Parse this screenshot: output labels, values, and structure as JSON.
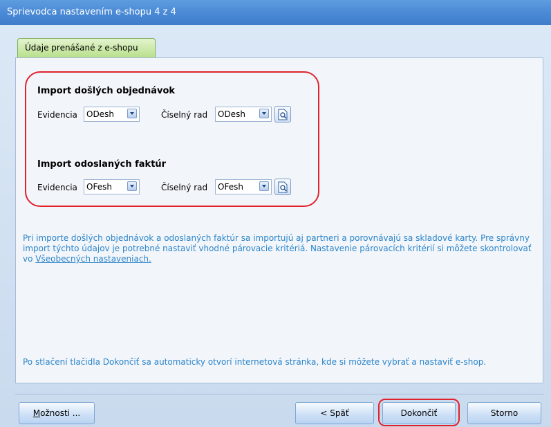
{
  "window": {
    "title": "Sprievodca nastavením e-shopu 4 z 4"
  },
  "tab": {
    "label": "Údaje prenášané z e-shopu"
  },
  "orders": {
    "title": "Import došlých objednávok",
    "evidencia_label": "Evidencia",
    "evidencia_value": "ODesh",
    "rad_label": "Číselný rad",
    "rad_value": "ODesh"
  },
  "invoices": {
    "title": "Import odoslaných faktúr",
    "evidencia_label": "Evidencia",
    "evidencia_value": "OFesh",
    "rad_label": "Číselný rad",
    "rad_value": "OFesh"
  },
  "info": {
    "text": "Pri importe došlých objednávok a odoslaných faktúr sa importujú aj partneri a porovnávajú sa skladové karty. Pre správny import týchto údajov je potrebné nastaviť vhodné párovacie kritériá. Nastavenie párovacích kritérií si môžete skontrolovať vo ",
    "link": "Všeobecných nastaveniach.",
    "finish_note": "Po stlačení tlačidla Dokončiť sa automaticky otvorí internetová stránka, kde si môžete vybrať a nastaviť e-shop."
  },
  "buttons": {
    "options_first": "M",
    "options_rest": "ožnosti ...",
    "back": "< Späť",
    "finish": "Dokončiť",
    "cancel": "Storno"
  },
  "colors": {
    "highlight": "#e1222b",
    "info_text": "#2c84c8",
    "titlebar": "#4b8bd6"
  },
  "icons": [
    "chevron-down-icon",
    "search-document-icon"
  ]
}
